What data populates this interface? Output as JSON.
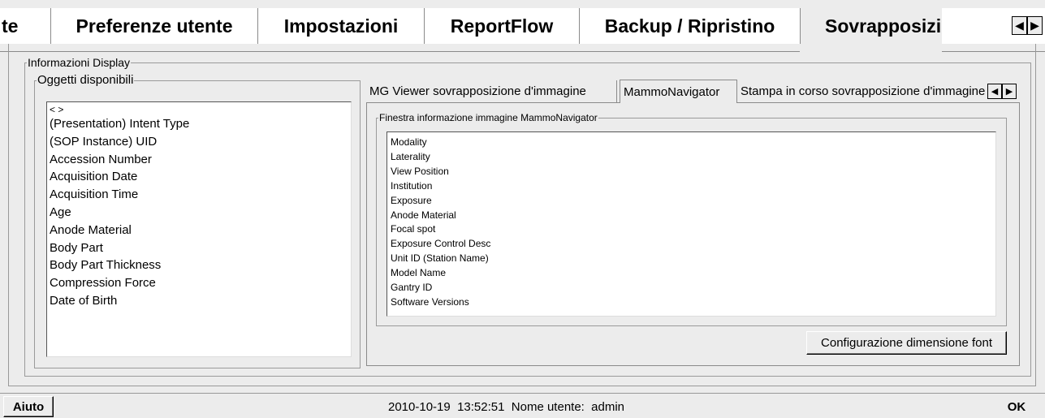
{
  "main_tabs": [
    {
      "label": "te"
    },
    {
      "label": "Preferenze utente"
    },
    {
      "label": "Impostazioni"
    },
    {
      "label": "ReportFlow"
    },
    {
      "label": "Backup / Ripristino"
    },
    {
      "label": "Sovrapposizione"
    }
  ],
  "display_info": {
    "legend": "Informazioni Display",
    "available": {
      "legend": "Oggetti disponibili",
      "items": [
        "< >",
        "(Presentation) Intent Type",
        "(SOP Instance) UID",
        "Accession Number",
        "Acquisition Date",
        "Acquisition Time",
        "Age",
        "Anode Material",
        "Body Part",
        "Body Part Thickness",
        "Compression Force",
        "Date of Birth"
      ]
    },
    "sub_tabs": [
      {
        "label": "MG Viewer sovrapposizione d'immagine"
      },
      {
        "label": "MammoNavigator"
      },
      {
        "label": "Stampa in corso sovrapposizione d'immagine"
      }
    ],
    "info_window": {
      "legend": "Finestra informazione immagine MammoNavigator",
      "items": [
        "Modality",
        "Laterality",
        "View Position",
        "Institution",
        "Exposure",
        "Anode Material",
        "Focal spot",
        "Exposure Control Desc",
        "Unit ID (Station Name)",
        "Model Name",
        "Gantry ID",
        "Software Versions"
      ]
    },
    "font_button": "Configurazione dimensione font"
  },
  "status_bar": {
    "help_button": "Aiuto",
    "status_text": "2010-10-19  13:52:51  Nome utente:  admin",
    "ok_button": "OK"
  }
}
